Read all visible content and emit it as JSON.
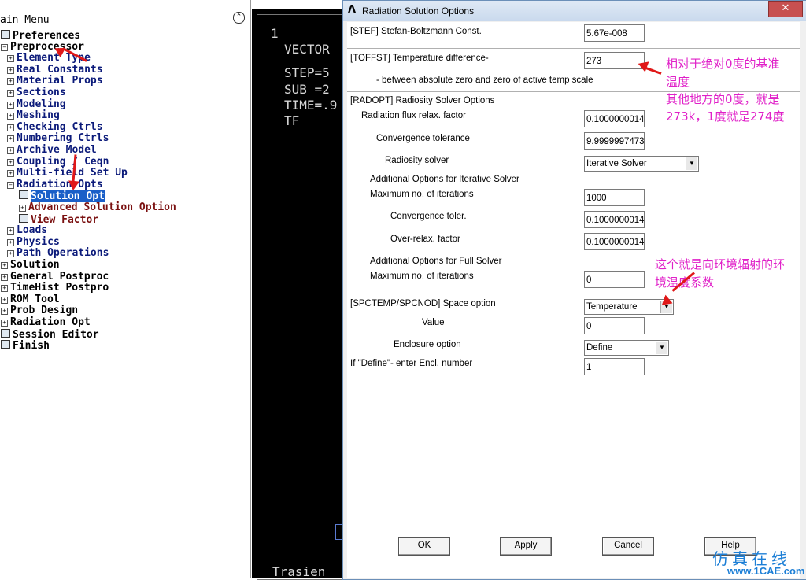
{
  "left_panel": {
    "title": "ain Menu",
    "items": [
      {
        "label": "Preferences",
        "level": 0,
        "type": "leaf"
      },
      {
        "label": "Preprocessor",
        "level": 0,
        "type": "open"
      },
      {
        "label": "Element Type",
        "level": 1,
        "type": "plus"
      },
      {
        "label": "Real Constants",
        "level": 1,
        "type": "plus"
      },
      {
        "label": "Material Props",
        "level": 1,
        "type": "plus"
      },
      {
        "label": "Sections",
        "level": 1,
        "type": "plus"
      },
      {
        "label": "Modeling",
        "level": 1,
        "type": "plus"
      },
      {
        "label": "Meshing",
        "level": 1,
        "type": "plus"
      },
      {
        "label": "Checking Ctrls",
        "level": 1,
        "type": "plus"
      },
      {
        "label": "Numbering Ctrls",
        "level": 1,
        "type": "plus"
      },
      {
        "label": "Archive Model",
        "level": 1,
        "type": "plus"
      },
      {
        "label": "Coupling / Ceqn",
        "level": 1,
        "type": "plus"
      },
      {
        "label": "Multi-field Set Up",
        "level": 1,
        "type": "plus"
      },
      {
        "label": "Radiation Opts",
        "level": 1,
        "type": "minus"
      },
      {
        "label": "Solution Opt",
        "level": 2,
        "type": "leaf",
        "selected": true
      },
      {
        "label": "Advanced Solution Option",
        "level": 2,
        "type": "plus"
      },
      {
        "label": "View Factor",
        "level": 2,
        "type": "leaf"
      },
      {
        "label": "Loads",
        "level": 1,
        "type": "plus"
      },
      {
        "label": "Physics",
        "level": 1,
        "type": "plus"
      },
      {
        "label": "Path Operations",
        "level": 1,
        "type": "plus"
      },
      {
        "label": "Solution",
        "level": 0,
        "type": "plus"
      },
      {
        "label": "General Postproc",
        "level": 0,
        "type": "plus"
      },
      {
        "label": "TimeHist Postpro",
        "level": 0,
        "type": "plus"
      },
      {
        "label": "ROM Tool",
        "level": 0,
        "type": "plus"
      },
      {
        "label": "Prob Design",
        "level": 0,
        "type": "plus"
      },
      {
        "label": "Radiation Opt",
        "level": 0,
        "type": "plus"
      },
      {
        "label": "Session Editor",
        "level": 0,
        "type": "leaf"
      },
      {
        "label": "Finish",
        "level": 0,
        "type": "leaf"
      }
    ]
  },
  "graphics": {
    "lines": [
      "1",
      "VECTOR",
      "STEP=5",
      "SUB =2",
      "TIME=.9",
      "TF"
    ],
    "bottom_text": "Trasien"
  },
  "dialog": {
    "title": "Radiation Solution Options",
    "close_label": "✕",
    "stef": {
      "label": "[STEF]  Stefan-Boltzmann Const.",
      "value": "5.67e-008"
    },
    "toffst": {
      "label": "[TOFFST] Temperature difference-",
      "sublabel": "- between absolute zero and zero of active temp scale",
      "value": "273"
    },
    "radopt": {
      "header": "[RADOPT] Radiosity Solver Options",
      "flux_label": "Radiation flux relax. factor",
      "flux_value": "0.1000000014",
      "conv_label": "Convergence tolerance",
      "conv_value": "9.9999997473",
      "solver_label": "Radiosity solver",
      "solver_value": "Iterative Solver",
      "iter_header": "Additional Options for Iterative Solver",
      "iter_max_label": "Maximum no. of iterations",
      "iter_max_value": "1000",
      "iter_conv_label": "Convergence toler.",
      "iter_conv_value": "0.1000000014",
      "iter_relax_label": "Over-relax. factor",
      "iter_relax_value": "0.1000000014",
      "full_header": "Additional Options for Full Solver",
      "full_max_label": "Maximum no. of iterations",
      "full_max_value": "0"
    },
    "spc": {
      "label": "[SPCTEMP/SPCNOD]  Space option",
      "option_value": "Temperature",
      "value_label": "Value",
      "value": "0",
      "encl_label": "Enclosure option",
      "encl_value": "Define",
      "encl_num_label": "If \"Define\"- enter Encl. number",
      "encl_num_value": "1"
    },
    "buttons": {
      "ok": "OK",
      "apply": "Apply",
      "cancel": "Cancel",
      "help": "Help"
    }
  },
  "annotations": {
    "note1_line1": "相对于绝对0度的基准",
    "note1_line2": "温度",
    "note1_line3": "其他地方的0度，就是",
    "note1_line4": "273k，1度就是274度",
    "note2_line1": "这个就是向环境辐射的环",
    "note2_line2": "境温度系数",
    "color": "#e020c8",
    "arrow_color": "#e01818"
  },
  "watermark": {
    "line1": "仿真在线",
    "line2": "www.1CAE.com"
  }
}
